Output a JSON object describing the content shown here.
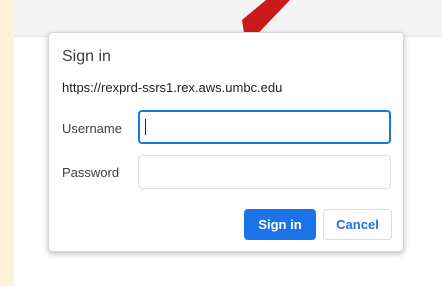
{
  "dialog": {
    "title": "Sign in",
    "url": "https://rexprd-ssrs1.rex.aws.umbc.edu",
    "username_label": "Username",
    "username_value": "",
    "password_label": "Password",
    "password_value": "",
    "signin_label": "Sign in",
    "cancel_label": "Cancel"
  },
  "colors": {
    "accent": "#1a73e8",
    "arrow": "#cc1a1a",
    "page_bg": "#fdf2d8"
  },
  "icons": {
    "annotation": "red-arrow-icon"
  }
}
